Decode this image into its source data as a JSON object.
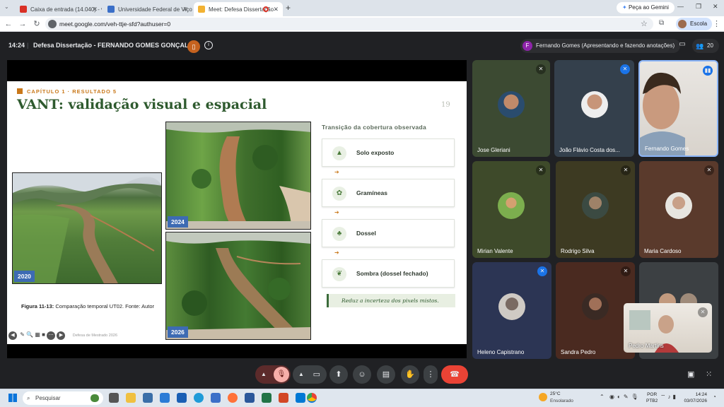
{
  "browser": {
    "tabs": [
      {
        "title": "Caixa de entrada (14.040) - ven",
        "icon": "gmail-icon",
        "color": "#d93025"
      },
      {
        "title": "Universidade Federal de Viçosa",
        "icon": "ufv-icon",
        "color": "#3b6fc8"
      },
      {
        "title": "Meet: Defesa Dissertação -",
        "icon": "meet-icon",
        "color": "#f2b233"
      }
    ],
    "gemini_label": "Peça ao Gemini",
    "url": "meet.google.com/veh-ttje-sfd?authuser=0",
    "profile_label": "Escola"
  },
  "meet": {
    "time": "14:24",
    "meeting_title": "Defesa Dissertação - FERNANDO GOMES GONÇAL...",
    "presenter_initial": "F",
    "presenter_text": "Fernando Gomes (Apresentando e fazendo anotações)",
    "participant_count": "20"
  },
  "slide": {
    "chapter": "CAPÍTULO 1 · RESULTADO 5",
    "title": "VANT: validação visual e espacial",
    "page_number": "19",
    "year_2020": "2020",
    "year_2024": "2024",
    "year_2026": "2026",
    "caption_bold": "Figura 11-13:",
    "caption_rest": "Comparação temporal UT02. Fonte: Autor",
    "footer": "Defesa de Mestrado 2026",
    "transition_title": "Transição da cobertura observada",
    "steps": [
      "Solo exposto",
      "Gramíneas",
      "Dossel",
      "Sombra (dossel fechado)"
    ],
    "note": "Reduz a incerteza dos pixels mistos.",
    "accent": "#c9781a",
    "green": "#3b6b3b"
  },
  "participants": [
    {
      "name": "Jose Gleriani"
    },
    {
      "name": "João Flávio Costa dos..."
    },
    {
      "name": "Fernando Gomes"
    },
    {
      "name": "Mirian Valente"
    },
    {
      "name": "Rodrigo Silva"
    },
    {
      "name": "Maria Cardoso"
    },
    {
      "name": "Heleno Capistrano"
    },
    {
      "name": "Sandra Pedro"
    },
    {
      "name": "Pedro Martins"
    }
  ],
  "taskbar": {
    "search_placeholder": "Pesquisar",
    "weather_temp": "25°C",
    "weather_desc": "Ensolarado",
    "lang_top": "POR",
    "lang_bottom": "PTB2",
    "clock_time": "14:24",
    "clock_date": "03/07/2026"
  }
}
